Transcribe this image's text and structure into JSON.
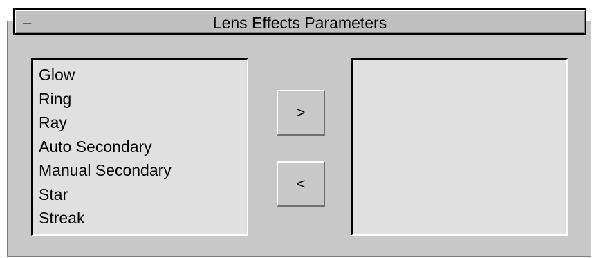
{
  "rollout": {
    "title": "Lens Effects Parameters",
    "collapse_symbol": "–"
  },
  "available_effects": [
    "Glow",
    "Ring",
    "Ray",
    "Auto Secondary",
    "Manual Secondary",
    "Star",
    "Streak"
  ],
  "selected_effects": [],
  "buttons": {
    "add_label": ">",
    "remove_label": "<"
  }
}
